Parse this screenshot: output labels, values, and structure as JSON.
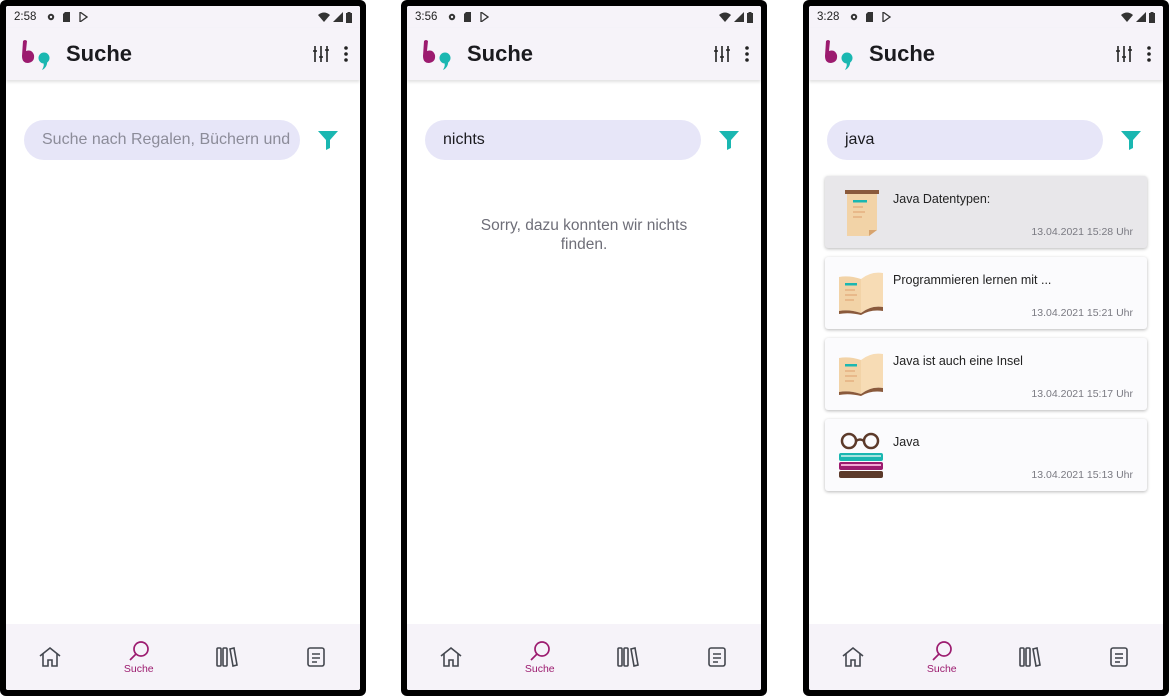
{
  "app_title": "Suche",
  "colors": {
    "brand_magenta": "#9c1b6f",
    "brand_teal": "#1ab7b1",
    "search_bg": "#e7e6f8",
    "appbar_bg": "#f6f3f9"
  },
  "nav": {
    "search_label": "Suche"
  },
  "screens": [
    {
      "time": "2:58",
      "search_placeholder": "Suche nach Regalen, Büchern und",
      "search_value": ""
    },
    {
      "time": "3:56",
      "search_value": "nichts",
      "empty_message": "Sorry, dazu konnten wir nichts finden."
    },
    {
      "time": "3:28",
      "search_value": "java",
      "results": [
        {
          "title": "Java Datentypen:",
          "date": "13.04.2021 15:28 Uhr",
          "icon": "note-icon",
          "selected": true
        },
        {
          "title": "Programmieren lernen mit  ...",
          "date": "13.04.2021 15:21 Uhr",
          "icon": "open-book-icon",
          "selected": false
        },
        {
          "title": "Java ist auch eine Insel",
          "date": "13.04.2021 15:17 Uhr",
          "icon": "open-book-icon",
          "selected": false
        },
        {
          "title": "Java",
          "date": "13.04.2021 15:13 Uhr",
          "icon": "books-glasses-icon",
          "selected": false
        }
      ]
    }
  ]
}
